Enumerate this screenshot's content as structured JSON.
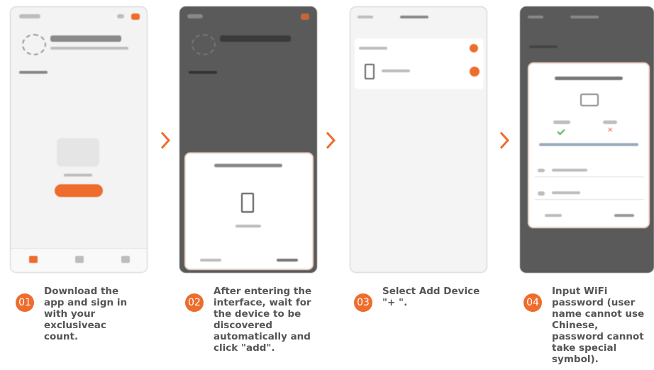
{
  "accent": "#ee6c2c",
  "steps": [
    {
      "num": "01",
      "text": "Download the app and sign in with your exclusiveac count."
    },
    {
      "num": "02",
      "text": "After entering the interface, wait for the device to be discovered automatically and click \"add\"."
    },
    {
      "num": "03",
      "text": "Select Add Device \"+ \"."
    },
    {
      "num": "04",
      "text": "Input WiFi password (user name cannot use Chinese, password cannot take special symbol)."
    }
  ]
}
